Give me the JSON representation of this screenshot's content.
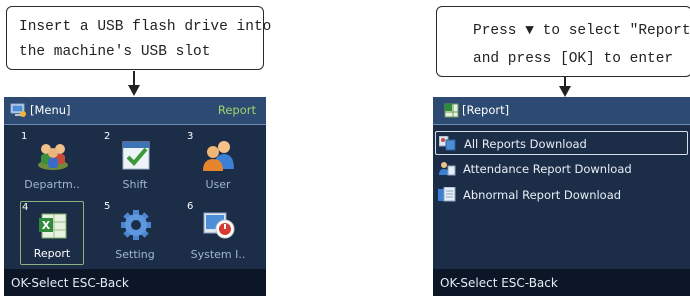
{
  "left_callout": {
    "lines": [
      "Insert a USB flash drive into",
      "the machine's USB slot"
    ]
  },
  "right_callout": {
    "lines": [
      "Press ▼ to select \"Report\"",
      "and press [OK] to enter"
    ]
  },
  "left_screen": {
    "title": "[Menu]",
    "title_icon": "monitor-icon",
    "selected_name": "Report",
    "tiles": [
      {
        "num": "1",
        "label": "Departm..",
        "icon": "people-group-icon"
      },
      {
        "num": "2",
        "label": "Shift",
        "icon": "calendar-check-icon"
      },
      {
        "num": "3",
        "label": "User",
        "icon": "users-icon"
      },
      {
        "num": "4",
        "label": "Report",
        "icon": "spreadsheet-icon",
        "selected": true
      },
      {
        "num": "5",
        "label": "Setting",
        "icon": "gear-icon"
      },
      {
        "num": "6",
        "label": "System I..",
        "icon": "system-info-icon"
      }
    ],
    "status": "OK-Select  ESC-Back"
  },
  "right_screen": {
    "title": "[Report]",
    "title_icon": "report-icon",
    "items": [
      {
        "label": "All Reports Download",
        "icon": "all-reports-icon",
        "selected": true
      },
      {
        "label": "Attendance Report Download",
        "icon": "attendance-icon"
      },
      {
        "label": "Abnormal Report Download",
        "icon": "abnormal-icon"
      }
    ],
    "status": "OK-Select  ESC-Back"
  },
  "colors": {
    "screen_bg": "#1c2d47",
    "titlebar_bg": "#2c4a72",
    "statusbar_bg": "#0c1626",
    "title_accent": "#a5d36a",
    "selection_border": "#8eb07a"
  }
}
